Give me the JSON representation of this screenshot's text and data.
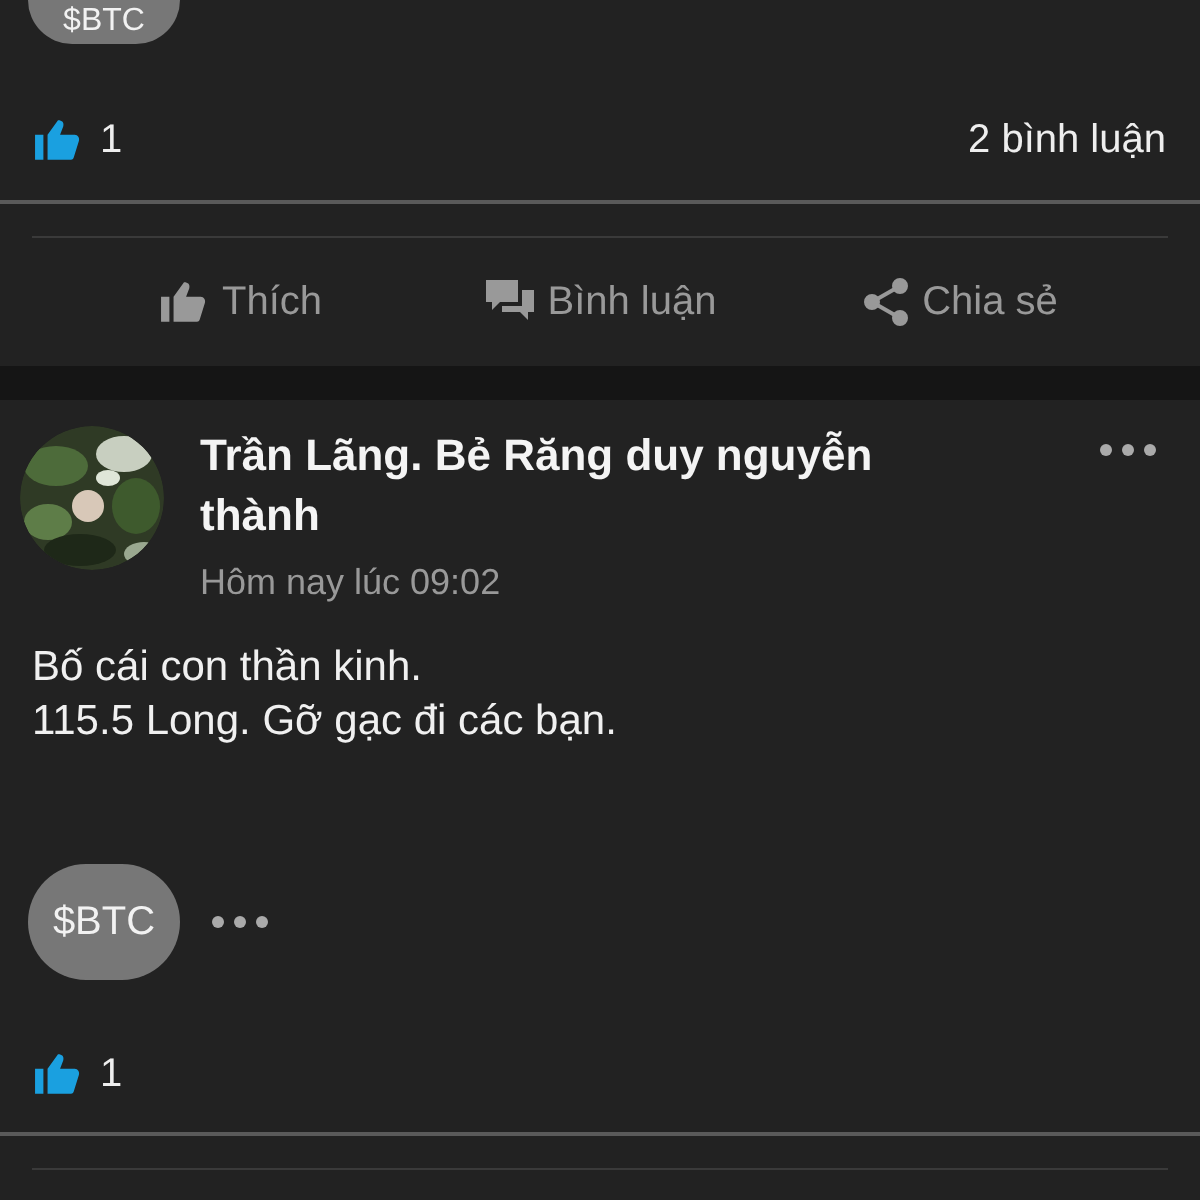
{
  "previous_post": {
    "tags": [
      {
        "label": "$BTC"
      }
    ],
    "liked": true,
    "likes": "1",
    "comments": "2 bình luận"
  },
  "actions": [
    {
      "kind": "like",
      "label": "Thích"
    },
    {
      "kind": "comment",
      "label": "Bình luận"
    },
    {
      "kind": "share",
      "label": "Chia sẻ"
    }
  ],
  "post": {
    "author": "Trần Lãng. Bẻ Răng duy nguyễn thành",
    "time": "Hôm nay lúc 09:02",
    "body": [
      "Bố cái con thần kinh.",
      "115.5 Long. Gỡ gạc đi các bạn."
    ],
    "tags": [
      {
        "label": "$BTC"
      }
    ],
    "liked": true,
    "likes": "1"
  }
}
